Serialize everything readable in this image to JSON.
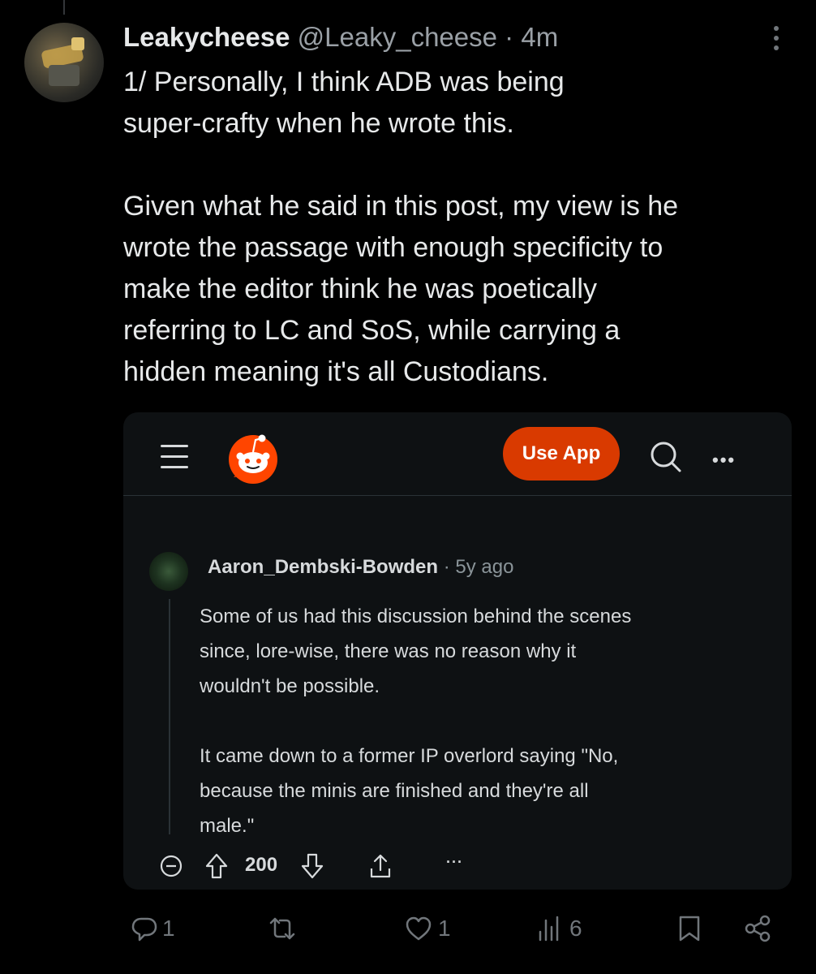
{
  "tweet": {
    "display_name": "Leakycheese",
    "handle": "@Leaky_cheese",
    "separator": "·",
    "time": "4m",
    "text_lines_1": [
      "1/ Personally, I think ADB was being",
      "super-crafty when he wrote this."
    ],
    "text_lines_2": [
      "Given what he said in this post, my view is he",
      "wrote the passage with enough specificity to",
      "make the editor think he was poetically",
      "referring to LC and SoS, while carrying a",
      "hidden meaning it's all Custodians."
    ]
  },
  "embed": {
    "use_app_label": "Use App",
    "comment": {
      "username": "Aaron_Dembski-Bowden",
      "separator": "·",
      "age": "5y ago",
      "para1": [
        "Some of us had this discussion behind the scenes",
        "since, lore-wise, there was no reason why it",
        "wouldn't be possible."
      ],
      "para2": [
        "It came down to a former IP overlord saying \"No,",
        "because the minis are finished and they're all",
        "male.\""
      ],
      "votes": "200",
      "more": "···"
    },
    "brand_color": "#d93a00"
  },
  "actions": {
    "replies": "1",
    "retweets": "",
    "likes": "1",
    "views": "6"
  },
  "icons": [
    "more-vertical-icon",
    "hamburger-menu-icon",
    "reddit-snoo-icon",
    "search-icon",
    "more-horizontal-icon",
    "collapse-icon",
    "upvote-icon",
    "downvote-icon",
    "share-icon",
    "reply-icon",
    "retweet-icon",
    "like-icon",
    "views-icon",
    "bookmark-icon",
    "share-network-icon"
  ]
}
